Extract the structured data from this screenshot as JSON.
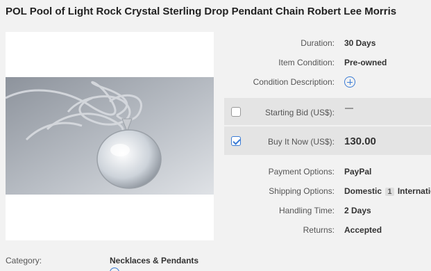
{
  "listing": {
    "title": "POL Pool of Light Rock Crystal Sterling Drop Pendant Chain Robert Lee Morris"
  },
  "details": {
    "duration_label": "Duration:",
    "duration_value": "30 Days",
    "condition_label": "Item Condition:",
    "condition_value": "Pre-owned",
    "condition_desc_label": "Condition Description:",
    "starting_bid_label": "Starting Bid (US$):",
    "starting_bid_checked": false,
    "buy_it_now_label": "Buy It Now (US$):",
    "buy_it_now_checked": true,
    "buy_it_now_price": "130.00",
    "payment_label": "Payment Options:",
    "payment_value": "PayPal",
    "shipping_label": "Shipping Options:",
    "shipping_domestic": "Domestic",
    "shipping_domestic_count": "1",
    "shipping_international": "International",
    "handling_label": "Handling Time:",
    "handling_value": "2 Days",
    "returns_label": "Returns:",
    "returns_value": "Accepted"
  },
  "footer": {
    "category_label": "Category:",
    "category_value": "Necklaces & Pendants"
  },
  "colors": {
    "accent": "#3a7bd5",
    "panel_band": "#e4e4e4",
    "background": "#f2f2f2"
  }
}
